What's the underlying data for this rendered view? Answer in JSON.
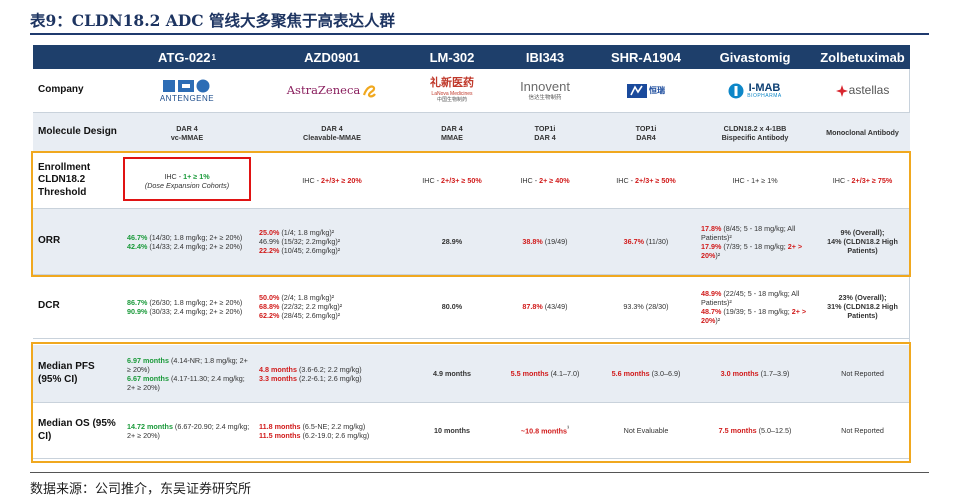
{
  "title": "表9：CLDN18.2 ADC 管线大多聚焦于高表达人群",
  "footer": "数据来源：公司推介，东吴证券研究所",
  "headers": [
    "",
    "ATG-022",
    "AZD0901",
    "LM-302",
    "IBI343",
    "SHR-A1904",
    "Givastomig",
    "Zolbetuximab"
  ],
  "header_sup": "1",
  "labels": {
    "company": "Company",
    "molecule": "Molecule Design",
    "enroll": "Enrollment CLDN18.2 Threshold",
    "orr": "ORR",
    "dcr": "DCR",
    "pfs": "Median PFS (95% CI)",
    "os": "Median OS (95% CI)"
  },
  "companies": {
    "antengene": "ANTENGENE",
    "astrazeneca": "AstraZeneca",
    "lm_cn": "礼新医药",
    "lm_en": "LaNova Medicines",
    "lm_sub": "中国生物制药",
    "innovent": "Innovent",
    "innovent_cn": "信达生物制药",
    "hengrui": "恒瑞",
    "imab": "I-MAB",
    "imab_sub": "BIOPHARMA",
    "astellas": "astellas"
  },
  "molecule": [
    [
      "DAR 4",
      "vc-MMAE"
    ],
    [
      "DAR 4",
      "Cleavable-MMAE"
    ],
    [
      "DAR 4",
      "MMAE"
    ],
    [
      "TOP1i",
      "DAR 4"
    ],
    [
      "TOP1i",
      "DAR4"
    ],
    [
      "CLDN18.2 x 4-1BB",
      "Bispecific Antibody"
    ],
    [
      "Monoclonal Antibody"
    ]
  ],
  "enroll": {
    "atg_a": "IHC - ",
    "atg_b": "1+ ≥ 1%",
    "atg_c": "(Dose Expansion Cohorts)",
    "azd_a": "IHC - ",
    "azd_b": "2+/3+ ≥ 20%",
    "lm_a": "IHC - ",
    "lm_b": "2+/3+ ≥ 50%",
    "ibi_a": "IHC - ",
    "ibi_b": "2+ ≥ 40%",
    "shr_a": "IHC - ",
    "shr_b": "2+/3+ ≥ 50%",
    "giv": "IHC - 1+ ≥ 1%",
    "zol_a": "IHC - ",
    "zol_b": "2+/3+ ≥ 75%"
  },
  "orr": {
    "atg1_v": "46.7%",
    "atg1_t": " (14/30; 1.8 mg/kg; 2+ ≥ 20%)",
    "atg2_v": "42.4%",
    "atg2_t": " (14/33; 2.4 mg/kg; 2+ ≥ 20%)",
    "azd1_v": "25.0%",
    "azd1_t": " (1/4; 1.8 mg/kg)²",
    "azd2": "46.9% (15/32; 2.2mg/kg)²",
    "azd3_v": "22.2%",
    "azd3_t": " (10/45; 2.6mg/kg)²",
    "lm": "28.9%",
    "ibi_v": "38.8%",
    "ibi_t": " (19/49)",
    "shr_v": "36.7%",
    "shr_t": " (11/30)",
    "giv1_v": "17.8%",
    "giv1_t": " (8/45; 5 - 18 mg/kg; All Patients)²",
    "giv2_v": "17.9%",
    "giv2_t": " (7/39; 5 - 18 mg/kg; ",
    "giv2_r": "2+ > 20%",
    "giv2_e": ")²",
    "zol1": "9% (Overall);",
    "zol2": "14% (CLDN18.2 High Patients)"
  },
  "dcr": {
    "atg1_v": "86.7%",
    "atg1_t": " (26/30; 1.8 mg/kg; 2+ ≥ 20%)",
    "atg2_v": "90.9%",
    "atg2_t": " (30/33; 2.4 mg/kg; 2+ ≥ 20%)",
    "azd1_v": "50.0%",
    "azd1_t": " (2/4; 1.8 mg/kg)²",
    "azd2_v": "68.8%",
    "azd2_t": " (22/32; 2.2 mg/kg)²",
    "azd3_v": "62.2%",
    "azd3_t": " (28/45; 2.6mg/kg)²",
    "lm": "80.0%",
    "ibi_v": "87.8%",
    "ibi_t": " (43/49)",
    "shr": "93.3% (28/30)",
    "giv1_v": "48.9%",
    "giv1_t": " (22/45; 5 - 18 mg/kg; All Patients)²",
    "giv2_v": "48.7%",
    "giv2_t": " (19/39; 5 - 18 mg/kg; ",
    "giv2_r": "2+ > 20%",
    "giv2_e": ")²",
    "zol1": "23% (Overall);",
    "zol2": "31% (CLDN18.2 High Patients)"
  },
  "pfs": {
    "atg1_v": "6.97 months",
    "atg1_t": " (4.14-NR; 1.8 mg/kg; 2+ ≥ 20%)",
    "atg2_v": "6.67 months",
    "atg2_t": " (4.17-11.30; 2.4 mg/kg; 2+ ≥ 20%)",
    "azd1_v": "4.8 months",
    "azd1_t": " (3.6-6.2; 2.2 mg/kg)",
    "azd2_v": "3.3 months",
    "azd2_t": " (2.2-6.1; 2.6 mg/kg)",
    "lm": "4.9 months",
    "ibi_v": "5.5 months",
    "ibi_t": " (4.1–7.0)",
    "shr_v": "5.6 months",
    "shr_t": " (3.0–6.9)",
    "giv_v": "3.0 months",
    "giv_t": " (1.7–3.9)",
    "zol": "Not Reported"
  },
  "os": {
    "atg1_v": "14.72 months",
    "atg1_t": " (6.67-20.90; 2.4 mg/kg; 2+ ≥ 20%)",
    "azd1_v": "11.8 months",
    "azd1_t": " (6.5-NE; 2.2 mg/kg)",
    "azd2_v": "11.5 months",
    "azd2_t": " (6.2-19.0; 2.6 mg/kg)",
    "lm": "10 months",
    "ibi_v": "~10.8 months",
    "ibi_t": "³",
    "shr": "Not Evaluable",
    "giv_v": "7.5 months",
    "giv_t": " (5.0–12.5)",
    "zol": "Not Reported"
  },
  "colors": {
    "header": "#1e3f6b",
    "green": "#1a9a3a",
    "red": "#d11b1b",
    "highlight": "#f0a81f",
    "box": "#e01313"
  }
}
